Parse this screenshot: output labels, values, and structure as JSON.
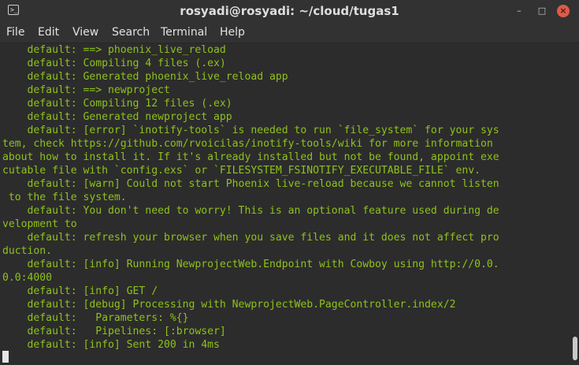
{
  "window": {
    "title": "rosyadi@rosyadi: ~/cloud/tugas1"
  },
  "menu": [
    "File",
    "Edit",
    "View",
    "Search",
    "Terminal",
    "Help"
  ],
  "icons": {
    "app": "terminal-icon",
    "minimize": "minimize-icon",
    "maximize": "maximize-icon",
    "close": "close-icon"
  },
  "colors": {
    "text": "#8ec21b",
    "background": "#2c2c2c",
    "close_button": "#e05a47"
  },
  "terminal": {
    "lines": [
      "    default: ==> phoenix_live_reload",
      "    default: Compiling 4 files (.ex)",
      "    default: Generated phoenix_live_reload app",
      "    default: ==> newproject",
      "    default: Compiling 12 files (.ex)",
      "    default: Generated newproject app",
      "    default: [error] `inotify-tools` is needed to run `file_system` for your sys",
      "tem, check https://github.com/rvoicilas/inotify-tools/wiki for more information",
      "about how to install it. If it's already installed but not be found, appoint exe",
      "cutable file with `config.exs` or `FILESYSTEM_FSINOTIFY_EXECUTABLE_FILE` env.",
      "    default: [warn] Could not start Phoenix live-reload because we cannot listen",
      " to the file system.",
      "    default: You don't need to worry! This is an optional feature used during de",
      "velopment to",
      "    default: refresh your browser when you save files and it does not affect pro",
      "duction.",
      "    default: [info] Running NewprojectWeb.Endpoint with Cowboy using http://0.0.",
      "0.0:4000",
      "    default: [info] GET /",
      "    default: [debug] Processing with NewprojectWeb.PageController.index/2",
      "    default:   Parameters: %{}",
      "    default:   Pipelines: [:browser]",
      "    default: [info] Sent 200 in 4ms"
    ]
  }
}
